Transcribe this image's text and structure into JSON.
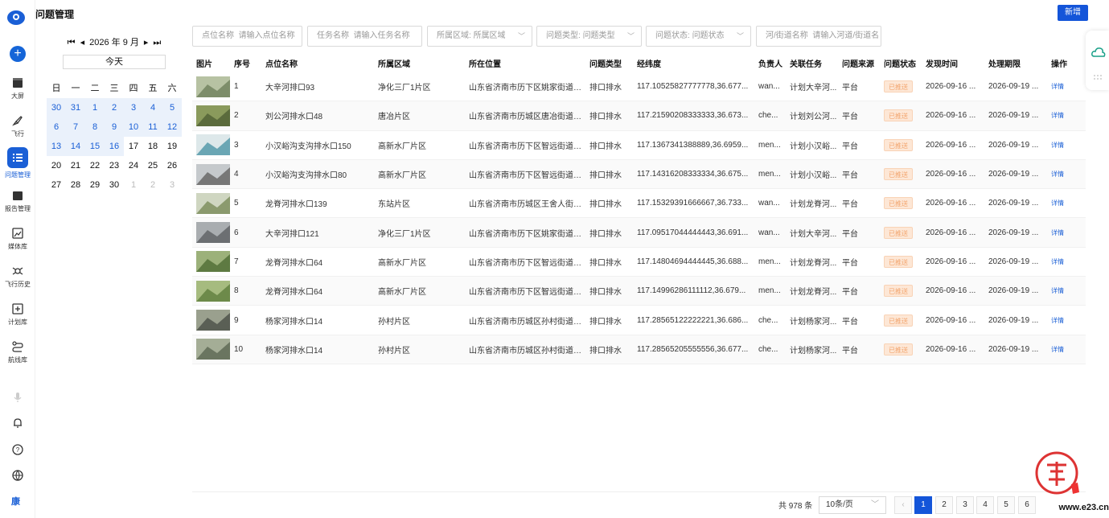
{
  "page_title": "问题管理",
  "add_label": "新增",
  "nav": {
    "items": [
      {
        "label": "大屏",
        "icon": "dashboard-icon"
      },
      {
        "label": "飞行",
        "icon": "rocket-icon"
      },
      {
        "label": "问题管理",
        "icon": "list-icon"
      },
      {
        "label": "报告管理",
        "icon": "folder-icon"
      },
      {
        "label": "媒体库",
        "icon": "media-icon"
      },
      {
        "label": "飞行历史",
        "icon": "drone-icon"
      },
      {
        "label": "计划库",
        "icon": "plan-icon"
      },
      {
        "label": "航线库",
        "icon": "route-icon"
      }
    ],
    "avatar_text": "康"
  },
  "calendar": {
    "month_label": "2026 年 9 月",
    "today_label": "今天",
    "weekdays": [
      "日",
      "一",
      "二",
      "三",
      "四",
      "五",
      "六"
    ],
    "weeks": [
      [
        "30",
        "31",
        "1",
        "2",
        "3",
        "4",
        "5"
      ],
      [
        "6",
        "7",
        "8",
        "9",
        "10",
        "11",
        "12"
      ],
      [
        "13",
        "14",
        "15",
        "16",
        "17",
        "18",
        "19"
      ],
      [
        "20",
        "21",
        "22",
        "23",
        "24",
        "25",
        "26"
      ],
      [
        "27",
        "28",
        "29",
        "30",
        "1",
        "2",
        "3"
      ]
    ]
  },
  "filters": [
    {
      "label": "点位名称",
      "placeholder": "请输入点位名称"
    },
    {
      "label": "任务名称",
      "placeholder": "请输入任务名称"
    },
    {
      "label": "所属区域:",
      "placeholder": "所属区域"
    },
    {
      "label": "问题类型:",
      "placeholder": "问题类型"
    },
    {
      "label": "问题状态:",
      "placeholder": "问题状态"
    },
    {
      "label": "河/街道名称",
      "placeholder": "请输入河道/街道名"
    }
  ],
  "table": {
    "headers": [
      "图片",
      "序号",
      "点位名称",
      "所属区域",
      "所在位置",
      "问题类型",
      "经纬度",
      "负责人",
      "关联任务",
      "问题来源",
      "问题状态",
      "发现时间",
      "处理期限",
      "操作"
    ],
    "rows": [
      {
        "no": "1",
        "name": "大辛河排口93",
        "area": "净化三厂1片区",
        "loc": "山东省济南市历下区姚家街道工...",
        "type": "排口排水",
        "coord": "117.10525827777778,36.677...",
        "owner": "wan...",
        "task": "计划大辛河...",
        "source": "平台",
        "status": "已推送",
        "found": "2026-09-16 ...",
        "deadline": "2026-09-19 ...",
        "action": "详情"
      },
      {
        "no": "2",
        "name": "刘公河排水口48",
        "area": "唐冶片区",
        "loc": "山东省济南市历城区唐冶街道经...",
        "type": "排口排水",
        "coord": "117.21590208333333,36.673...",
        "owner": "che...",
        "task": "计划刘公河...",
        "source": "平台",
        "status": "已推送",
        "found": "2026-09-16 ...",
        "deadline": "2026-09-19 ...",
        "action": "详情"
      },
      {
        "no": "3",
        "name": "小汉峪沟支沟排水口150",
        "area": "高新水厂片区",
        "loc": "山东省济南市历下区智远街道开...",
        "type": "排口排水",
        "coord": "117.1367341388889,36.6959...",
        "owner": "men...",
        "task": "计划小汉峪...",
        "source": "平台",
        "status": "已推送",
        "found": "2026-09-16 ...",
        "deadline": "2026-09-19 ...",
        "action": "详情"
      },
      {
        "no": "4",
        "name": "小汉峪沟支沟排水口80",
        "area": "高新水厂片区",
        "loc": "山东省济南市历下区智远街道开...",
        "type": "排口排水",
        "coord": "117.14316208333334,36.675...",
        "owner": "men...",
        "task": "计划小汉峪...",
        "source": "平台",
        "status": "已推送",
        "found": "2026-09-16 ...",
        "deadline": "2026-09-19 ...",
        "action": "详情"
      },
      {
        "no": "5",
        "name": "龙脊河排水口139",
        "area": "东站片区",
        "loc": "山东省济南市历城区王舍人街道...",
        "type": "排口排水",
        "coord": "117.15329391666667,36.733...",
        "owner": "wan...",
        "task": "计划龙脊河...",
        "source": "平台",
        "status": "已推送",
        "found": "2026-09-16 ...",
        "deadline": "2026-09-19 ...",
        "action": "详情"
      },
      {
        "no": "6",
        "name": "大辛河排口121",
        "area": "净化三厂1片区",
        "loc": "山东省济南市历下区姚家街道假...",
        "type": "排口排水",
        "coord": "117.09517044444443,36.691...",
        "owner": "wan...",
        "task": "计划大辛河...",
        "source": "平台",
        "status": "已推送",
        "found": "2026-09-16 ...",
        "deadline": "2026-09-19 ...",
        "action": "详情"
      },
      {
        "no": "7",
        "name": "龙脊河排水口64",
        "area": "高新水厂片区",
        "loc": "山东省济南市历下区智远街道凤...",
        "type": "排口排水",
        "coord": "117.14804694444445,36.688...",
        "owner": "men...",
        "task": "计划龙脊河...",
        "source": "平台",
        "status": "已推送",
        "found": "2026-09-16 ...",
        "deadline": "2026-09-19 ...",
        "action": "详情"
      },
      {
        "no": "8",
        "name": "龙脊河排水口64",
        "area": "高新水厂片区",
        "loc": "山东省济南市历下区智远街道凤...",
        "type": "排口排水",
        "coord": "117.14996286111112,36.679...",
        "owner": "men...",
        "task": "计划龙脊河...",
        "source": "平台",
        "status": "已推送",
        "found": "2026-09-16 ...",
        "deadline": "2026-09-19 ...",
        "action": "详情"
      },
      {
        "no": "9",
        "name": "杨家河排水口14",
        "area": "孙村片区",
        "loc": "山东省济南市历城区孙村街道科...",
        "type": "排口排水",
        "coord": "117.28565122222221,36.686...",
        "owner": "che...",
        "task": "计划杨家河...",
        "source": "平台",
        "status": "已推送",
        "found": "2026-09-16 ...",
        "deadline": "2026-09-19 ...",
        "action": "详情"
      },
      {
        "no": "10",
        "name": "杨家河排水口14",
        "area": "孙村片区",
        "loc": "山东省济南市历城区孙村街道科...",
        "type": "排口排水",
        "coord": "117.28565205555556,36.677...",
        "owner": "che...",
        "task": "计划杨家河...",
        "source": "平台",
        "status": "已推送",
        "found": "2026-09-16 ...",
        "deadline": "2026-09-19 ...",
        "action": "详情"
      }
    ]
  },
  "pagination": {
    "total": "共 978 条",
    "page_size": "10条/页",
    "pages": [
      "1",
      "2",
      "3",
      "4",
      "5",
      "6"
    ],
    "current": "1"
  },
  "watermark_text": "www.e23.cn",
  "colors": {
    "primary": "#1455d9",
    "tag_bg": "#fde7d6",
    "tag_text": "#f2a36b"
  }
}
